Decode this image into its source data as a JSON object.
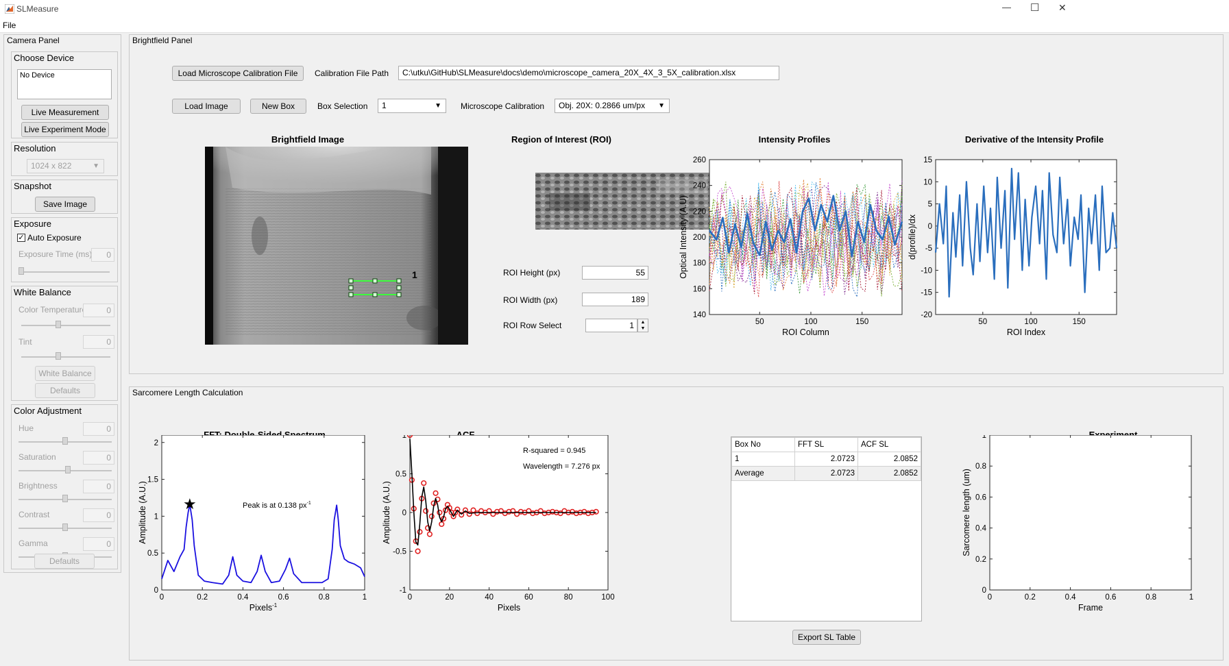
{
  "window": {
    "title": "SLMeasure",
    "minimize": "—",
    "maximize": "☐",
    "close": "✕"
  },
  "menu": {
    "file": "File"
  },
  "camera_panel": {
    "title": "Camera Panel",
    "choose_device": {
      "title": "Choose Device",
      "device_list_item": "No Device",
      "live_measurement": "Live Measurement Mode",
      "live_experiment": "Live Experiment Mode"
    },
    "resolution": {
      "title": "Resolution",
      "value": "1024 x 822"
    },
    "snapshot": {
      "title": "Snapshot",
      "save_image": "Save Image"
    },
    "exposure": {
      "title": "Exposure",
      "auto_exposure": "Auto Exposure",
      "auto_checked": true,
      "exposure_time_label": "Exposure Time (ms)",
      "exposure_time_value": "0"
    },
    "white_balance": {
      "title": "White Balance",
      "color_temp_label": "Color Temperature",
      "color_temp_value": "0",
      "tint_label": "Tint",
      "tint_value": "0",
      "white_balance_button": "White Balance",
      "defaults": "Defaults"
    },
    "color_adjustment": {
      "title": "Color Adjustment",
      "hue_label": "Hue",
      "hue_value": "0",
      "saturation_label": "Saturation",
      "saturation_value": "0",
      "brightness_label": "Brightness",
      "brightness_value": "0",
      "contrast_label": "Contrast",
      "contrast_value": "0",
      "gamma_label": "Gamma",
      "gamma_value": "0",
      "defaults": "Defaults"
    }
  },
  "brightfield_panel": {
    "title": "Brightfield Panel",
    "load_calibration": "Load Microscope Calibration File",
    "calibration_path_label": "Calibration File Path",
    "calibration_path": "C:\\utku\\GitHub\\SLMeasure\\docs\\demo\\microscope_camera_20X_4X_3_5X_calibration.xlsx",
    "load_image": "Load Image",
    "new_box": "New Box",
    "box_selection_label": "Box Selection",
    "box_selection_value": "1",
    "microscope_calibration_label": "Microscope Calibration",
    "microscope_calibration_value": "Obj. 20X: 0.2866 um/px",
    "brightfield_title": "Brightfield Image",
    "box_label": "1",
    "roi_title": "Region of Interest (ROI)",
    "roi_height_label": "ROI Height (px)",
    "roi_height_value": "55",
    "roi_width_label": "ROI Width (px)",
    "roi_width_value": "189",
    "roi_row_label": "ROI Row Select",
    "roi_row_value": "1"
  },
  "sl_panel": {
    "title": "Sarcomere Length Calculation",
    "table": {
      "headers": [
        "Box No",
        "FFT SL",
        "ACF SL"
      ],
      "rows": [
        [
          "1",
          "2.0723",
          "2.0852"
        ],
        [
          "Average",
          "2.0723",
          "2.0852"
        ]
      ]
    },
    "export": "Export SL Table"
  },
  "chart_data": [
    {
      "type": "line",
      "title": "Intensity Profiles",
      "xlabel": "ROI Column",
      "ylabel": "Optical Intensity (A.U)",
      "xlim": [
        1,
        189
      ],
      "ylim": [
        140,
        260
      ],
      "xticks": [
        "50",
        "100",
        "150"
      ],
      "yticks": [
        "140",
        "160",
        "180",
        "200",
        "220",
        "240",
        "260"
      ],
      "series": [
        {
          "style": "bold",
          "color": "#2a6ebd",
          "x": [
            1,
            8,
            14,
            20,
            26,
            32,
            38,
            44,
            50,
            56,
            62,
            68,
            74,
            80,
            86,
            92,
            98,
            104,
            110,
            116,
            122,
            128,
            134,
            140,
            146,
            152,
            158,
            164,
            170,
            176,
            182,
            189
          ],
          "y": [
            205,
            198,
            215,
            188,
            210,
            192,
            218,
            195,
            186,
            212,
            190,
            205,
            196,
            214,
            188,
            220,
            230,
            205,
            225,
            212,
            232,
            205,
            220,
            185,
            212,
            196,
            225,
            205,
            198,
            216,
            194,
            212
          ]
        }
      ]
    },
    {
      "type": "line",
      "title": "Derivative of the Intensity Profile",
      "xlabel": "ROI Index",
      "ylabel": "d(profile)/dx",
      "xlim": [
        1,
        189
      ],
      "ylim": [
        -20,
        15
      ],
      "xticks": [
        "50",
        "100",
        "150"
      ],
      "yticks": [
        "-20",
        "-15",
        "-10",
        "-5",
        "0",
        "5",
        "10",
        "15"
      ],
      "series": [
        {
          "color": "#2a6ebd",
          "x": [
            1,
            5,
            9,
            12,
            15,
            19,
            22,
            26,
            29,
            33,
            37,
            40,
            44,
            47,
            51,
            55,
            58,
            62,
            65,
            69,
            73,
            76,
            80,
            83,
            87,
            91,
            94,
            98,
            101,
            105,
            109,
            112,
            116,
            119,
            123,
            127,
            130,
            134,
            138,
            141,
            145,
            149,
            152,
            156,
            160,
            163,
            167,
            171,
            174,
            178,
            182,
            185,
            189
          ],
          "y": [
            -6,
            5,
            -4,
            9,
            -16,
            3,
            -7,
            7,
            -9,
            10,
            -5,
            -11,
            5,
            -8,
            9,
            -6,
            4,
            -12,
            11,
            -5,
            8,
            -14,
            13,
            -3,
            12,
            -10,
            6,
            -9,
            2,
            9,
            -4,
            8,
            -12,
            12,
            -2,
            -6,
            11,
            -4,
            6,
            -9,
            2,
            -3,
            7,
            -15,
            4,
            -4,
            7,
            -10,
            9,
            -6,
            -5,
            3,
            -5
          ]
        }
      ]
    },
    {
      "type": "line",
      "title": "FFT: Double-Sided Spectrum",
      "xlabel": "Pixels",
      "xlabel_superscript": "-1",
      "ylabel": "Amplitude (A.U.)",
      "xlim": [
        0,
        1
      ],
      "ylim": [
        0,
        2.1
      ],
      "xticks": [
        "0",
        "0.2",
        "0.4",
        "0.6",
        "0.8",
        "1"
      ],
      "yticks": [
        "0",
        "0.5",
        "1",
        "1.5",
        "2"
      ],
      "annotation": "Peak  is  at  0.138  px",
      "annotation_superscript": "-1",
      "peak": {
        "x": 0.138,
        "y": 1.16
      },
      "series": [
        {
          "color": "#1a10e0",
          "x": [
            0,
            0.03,
            0.06,
            0.09,
            0.11,
            0.12,
            0.13,
            0.138,
            0.15,
            0.16,
            0.18,
            0.21,
            0.25,
            0.3,
            0.33,
            0.35,
            0.37,
            0.4,
            0.44,
            0.47,
            0.49,
            0.51,
            0.54,
            0.58,
            0.61,
            0.63,
            0.65,
            0.69,
            0.74,
            0.79,
            0.82,
            0.84,
            0.85,
            0.862,
            0.87,
            0.88,
            0.9,
            0.92,
            0.95,
            0.98,
            1.0
          ],
          "y": [
            0.15,
            0.4,
            0.25,
            0.45,
            0.55,
            0.85,
            1.05,
            1.16,
            0.95,
            0.6,
            0.2,
            0.12,
            0.1,
            0.08,
            0.2,
            0.45,
            0.2,
            0.12,
            0.1,
            0.25,
            0.47,
            0.25,
            0.1,
            0.12,
            0.28,
            0.43,
            0.22,
            0.1,
            0.1,
            0.1,
            0.15,
            0.55,
            0.95,
            1.15,
            0.95,
            0.6,
            0.42,
            0.38,
            0.35,
            0.3,
            0.18
          ]
        }
      ]
    },
    {
      "type": "line",
      "title": "ACF",
      "xlabel": "Pixels",
      "ylabel": "Amplitude (A.U.)",
      "xlim": [
        0,
        100
      ],
      "ylim": [
        -1,
        1
      ],
      "xticks": [
        "0",
        "20",
        "40",
        "60",
        "80",
        "100"
      ],
      "yticks": [
        "-1",
        "-0.5",
        "0",
        "0.5",
        "1"
      ],
      "annotations": [
        "R-squared = 0.945",
        "Wavelength  = 7.276 px"
      ],
      "series": [
        {
          "name": "acf",
          "style": "circles",
          "color": "#e02020",
          "x": [
            0,
            1,
            2,
            3,
            4,
            5,
            6,
            7,
            8,
            9,
            10,
            11,
            12,
            13,
            14,
            15,
            16,
            17,
            18,
            19,
            20,
            21,
            22,
            23,
            24,
            26,
            28,
            30,
            32,
            34,
            36,
            38,
            40,
            42,
            44,
            46,
            48,
            50,
            52,
            54,
            56,
            58,
            60,
            62,
            64,
            66,
            68,
            70,
            72,
            74,
            76,
            78,
            80,
            82,
            84,
            86,
            88,
            90,
            92,
            94
          ],
          "y": [
            1.0,
            0.42,
            0.05,
            -0.37,
            -0.5,
            -0.25,
            0.18,
            0.38,
            0.02,
            -0.2,
            -0.28,
            -0.05,
            0.12,
            0.25,
            0.17,
            0.0,
            -0.15,
            -0.08,
            0.03,
            0.1,
            0.06,
            0.0,
            -0.05,
            0.0,
            0.04,
            -0.03,
            0.03,
            -0.02,
            0.03,
            -0.01,
            0.02,
            0.0,
            0.02,
            -0.02,
            0.01,
            0.02,
            -0.01,
            0.01,
            0.02,
            -0.02,
            0.01,
            0.0,
            0.02,
            -0.01,
            0.0,
            0.02,
            -0.01,
            0.0,
            0.01,
            0.0,
            -0.01,
            0.02,
            0.0,
            0.01,
            -0.01,
            0.0,
            0.01,
            -0.01,
            0.0,
            0.01
          ]
        },
        {
          "name": "fit",
          "style": "line",
          "color": "#000000",
          "x": [
            0,
            1,
            2,
            3,
            4,
            5,
            6,
            7,
            8,
            9,
            10,
            11,
            12,
            13,
            14,
            15,
            16,
            17,
            18,
            19,
            20,
            22,
            24,
            26,
            28,
            30,
            35,
            40,
            45,
            50,
            60,
            70,
            80,
            94
          ],
          "y": [
            0.95,
            0.5,
            0.0,
            -0.38,
            -0.42,
            -0.15,
            0.2,
            0.33,
            0.15,
            -0.12,
            -0.24,
            -0.12,
            0.08,
            0.18,
            0.1,
            -0.06,
            -0.12,
            -0.06,
            0.05,
            0.08,
            0.04,
            -0.05,
            0.03,
            -0.02,
            0.02,
            -0.01,
            0.0,
            0.0,
            0.0,
            0.0,
            0.0,
            0.0,
            0.0,
            0.0
          ]
        }
      ]
    },
    {
      "type": "line",
      "title": "Experiment",
      "xlabel": "Frame",
      "ylabel": "Sarcomere length (um)",
      "xlim": [
        0,
        1
      ],
      "ylim": [
        0,
        1
      ],
      "xticks": [
        "0",
        "0.2",
        "0.4",
        "0.6",
        "0.8",
        "1"
      ],
      "yticks": [
        "0",
        "0.2",
        "0.4",
        "0.6",
        "0.8",
        "1"
      ],
      "series": []
    }
  ]
}
